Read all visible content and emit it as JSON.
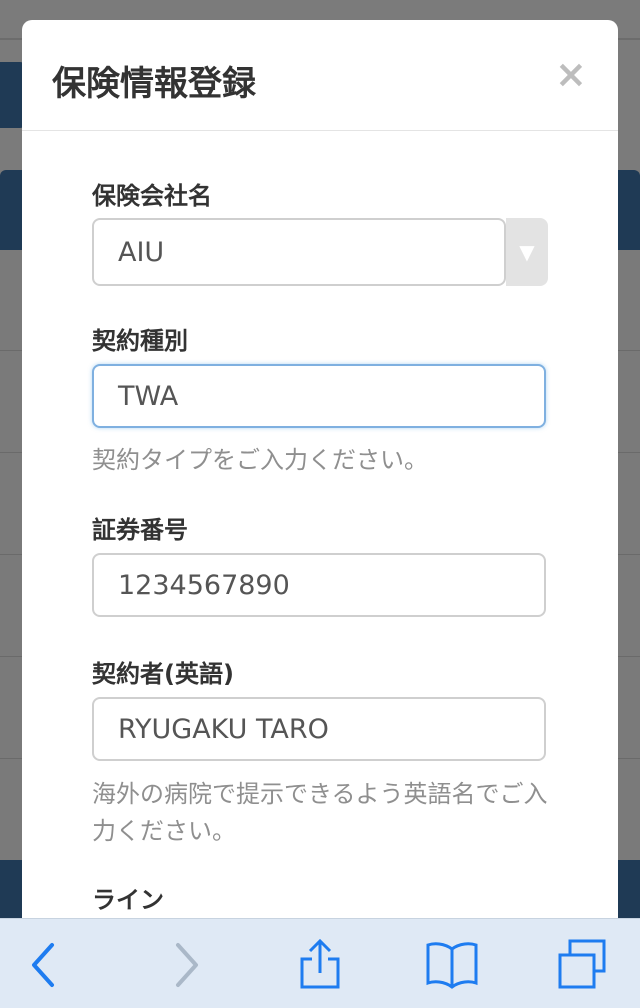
{
  "modal": {
    "title": "保険情報登録",
    "close_symbol": "×"
  },
  "form": {
    "insurance_company": {
      "label": "保険会社名",
      "value": "AIU",
      "arrow": "▼"
    },
    "contract_type": {
      "label": "契約種別",
      "value": "TWA",
      "help": "契約タイプをご入力ください。"
    },
    "policy_number": {
      "label": "証券番号",
      "value": "1234567890"
    },
    "policyholder_en": {
      "label": "契約者(英語)",
      "value": "RYUGAKU TARO",
      "help": "海外の病院で提示できるよう英語名でご入力ください。"
    },
    "line": {
      "label": "ライン"
    }
  },
  "toolbar": {
    "icons": [
      "back-chevron-icon",
      "forward-chevron-icon",
      "share-icon",
      "bookmarks-book-icon",
      "tabs-icon"
    ],
    "accent": "#1e7cf0",
    "disabled": "#aab8c8"
  }
}
